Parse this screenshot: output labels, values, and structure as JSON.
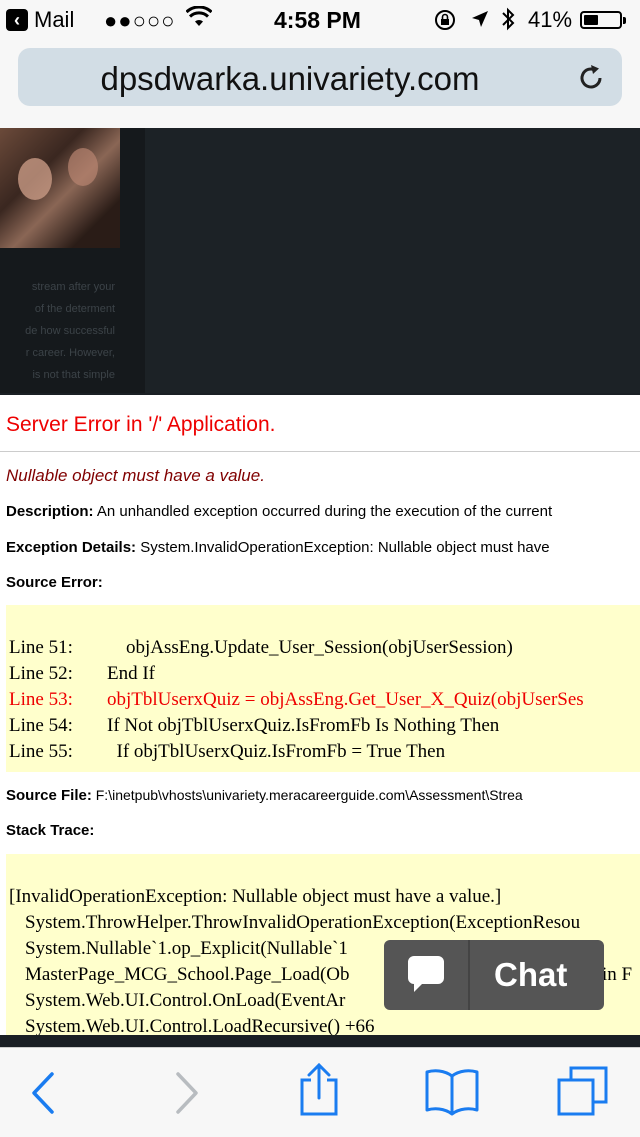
{
  "status_bar": {
    "back_app": "Mail",
    "signal": "●●○○○",
    "time": "4:58 PM",
    "battery_percent": "41%",
    "battery_level": 0.41
  },
  "browser": {
    "url": "dpsdwarka.univariety.com"
  },
  "background_page": {
    "faint_lines": [
      "stream after your",
      "of the determent",
      "de how successful",
      "r career. However,",
      "is not that simple"
    ]
  },
  "error": {
    "title": "Server Error in '/' Application.",
    "subtitle": "Nullable object must have a value.",
    "description_label": "Description:",
    "description_text": "An unhandled exception occurred during the execution of the current",
    "exception_label": "Exception Details:",
    "exception_text": "System.InvalidOperationException: Nullable object must have",
    "source_error_label": "Source Error:",
    "source_lines": [
      {
        "num": "Line 51:",
        "code": "    objAssEng.Update_User_Session(objUserSession)"
      },
      {
        "num": "Line 52:",
        "code": "End If"
      },
      {
        "num": "Line 53:",
        "code": "objTblUserxQuiz = objAssEng.Get_User_X_Quiz(objUserSes"
      },
      {
        "num": "Line 54:",
        "code": "If Not objTblUserxQuiz.IsFromFb Is Nothing Then"
      },
      {
        "num": "Line 55:",
        "code": "  If objTblUserxQuiz.IsFromFb = True Then"
      }
    ],
    "source_file_label": "Source File:",
    "source_file_text": "F:\\inetpub\\vhosts\\univariety.meracareerguide.com\\Assessment\\Strea",
    "stack_trace_label": "Stack Trace:",
    "stack_lines": [
      "[InvalidOperationException: Nullable object must have a value.]",
      "System.ThrowHelper.ThrowInvalidOperationException(ExceptionResou",
      "System.Nullable`1.op_Explicit(Nullable`1",
      "MasterPage_MCG_School.Page_Load(Ob",
      "System.Web.UI.Control.OnLoad(EventAr",
      "System.Web.UI.Control.LoadRecursive() +66"
    ],
    "stack_tail": "in F"
  },
  "chat": {
    "label": "Chat"
  },
  "colors": {
    "error_red": "#ee0000",
    "code_background": "#ffffcc",
    "ios_blue": "#1a7cf0"
  }
}
